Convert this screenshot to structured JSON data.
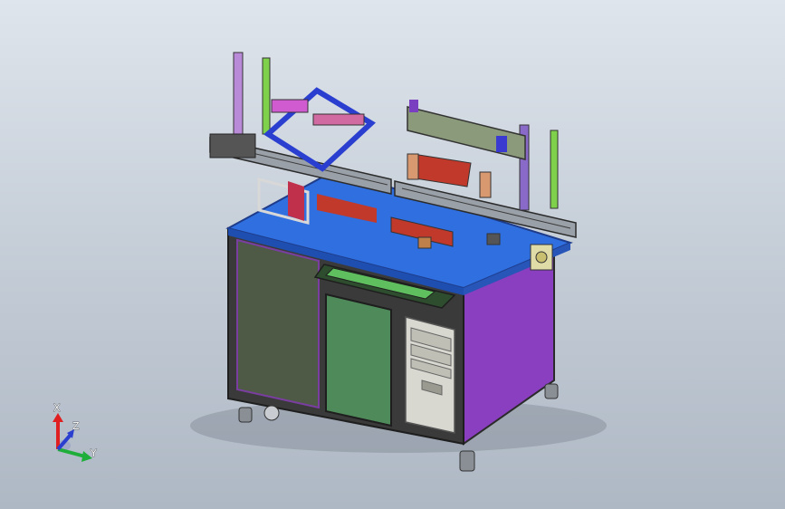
{
  "triad": {
    "x_label": "X",
    "y_label": "Y",
    "z_label": "Z"
  },
  "colors": {
    "background_top": "#dfe5ec",
    "background_bottom": "#aeb8c4",
    "table_top": "#2f6fe0",
    "left_door": "#4e5a46",
    "middle_door": "#4f8a5a",
    "side_panel": "#8a3ec0",
    "frame": "#2b2b2b",
    "rail_gray": "#9aa0a8",
    "gantry_red": "#c0392b",
    "pc_case": "#d8d8d0",
    "triad_x": "#e02020",
    "triad_y": "#1fae3a",
    "triad_z": "#2a3fd0"
  }
}
